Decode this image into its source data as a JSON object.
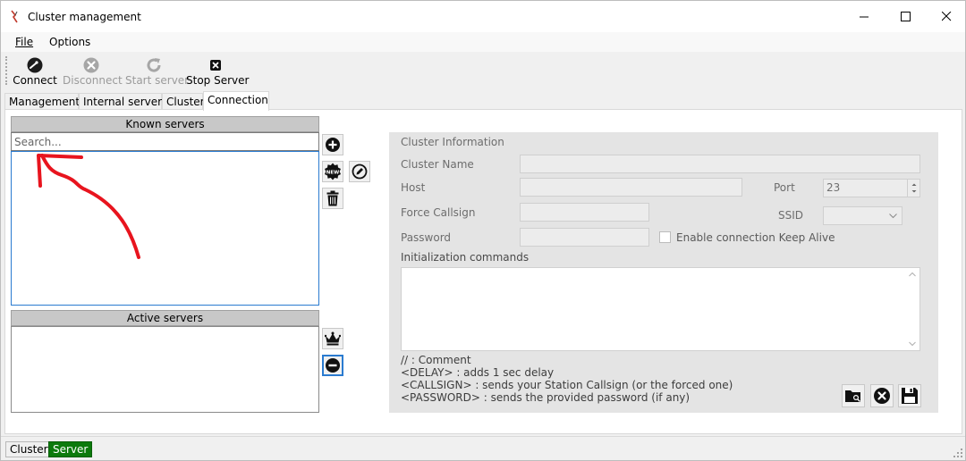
{
  "window": {
    "title": "Cluster management",
    "minimize_glyph": "─",
    "maximize_glyph": "☐",
    "close_glyph": "✕"
  },
  "menu": {
    "file": "File",
    "options": "Options"
  },
  "toolbar": {
    "connect": "Connect",
    "disconnect": "Disconnect",
    "start_server": "Start server",
    "stop_server": "Stop Server"
  },
  "tabs": [
    "Management",
    "Internal server",
    "Cluster",
    "Connection"
  ],
  "known_servers": {
    "header": "Known servers",
    "search_placeholder": "Search..."
  },
  "active_servers": {
    "header": "Active servers"
  },
  "cluster_info": {
    "title": "Cluster Information",
    "cluster_name_label": "Cluster Name",
    "host_label": "Host",
    "port_label": "Port",
    "port_value": "23",
    "force_callsign_label": "Force Callsign",
    "ssid_label": "SSID",
    "password_label": "Password",
    "keep_alive_label": "Enable connection Keep Alive",
    "init_commands_label": "Initialization commands",
    "help_lines": [
      "// : Comment",
      "<DELAY> : adds 1 sec delay",
      "<CALLSIGN> : sends your Station Callsign (or the forced one)",
      "<PASSWORD> : sends the provided password (if any)"
    ]
  },
  "icons": {
    "connect": "connect-icon",
    "disconnect": "disconnect-icon",
    "start_server": "refresh-icon",
    "stop_server": "stop-icon",
    "add": "add-icon",
    "new": "new-badge-icon",
    "edit": "edit-icon",
    "delete": "trash-icon",
    "crown": "crown-icon",
    "remove": "minus-icon",
    "open": "folder-open-icon",
    "clear": "clear-icon",
    "save": "save-icon"
  },
  "status_bar": {
    "cluster": "Cluster",
    "server": "Server"
  },
  "colors": {
    "server_active": "#0c7a0c",
    "annotation_arrow": "#e8141e",
    "focus_border": "#2a7bd0"
  }
}
